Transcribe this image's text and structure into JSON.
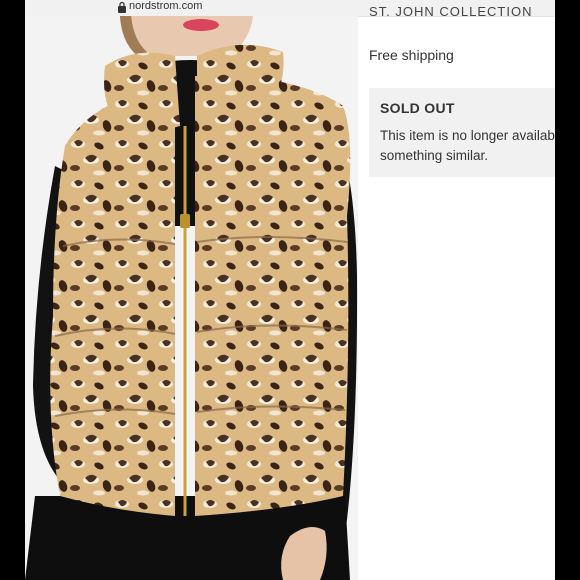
{
  "browser": {
    "url": "nordstrom.com"
  },
  "product": {
    "brand": "ST. JOHN COLLECTION",
    "shipping": "Free shipping",
    "status_title": "SOLD OUT",
    "status_line1": "This item is no longer availab",
    "status_line2": "something similar."
  },
  "image": {
    "subject": "model-wearing-leopard-print-puffer-vest"
  },
  "colors": {
    "frame": "#000000",
    "panel": "#f1f1f1",
    "leopard_base": "#d8b27c",
    "leopard_spot": "#4a3020"
  }
}
